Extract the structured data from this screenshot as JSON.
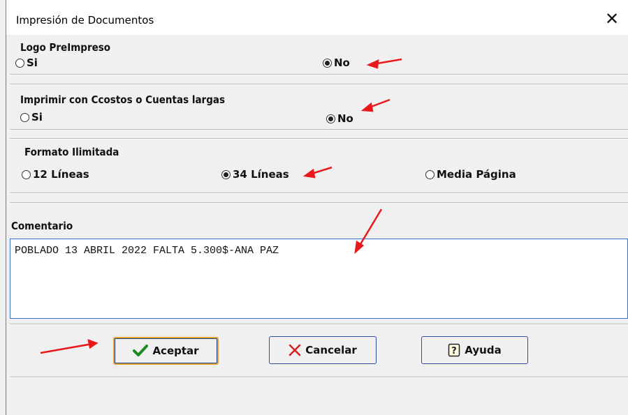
{
  "window": {
    "title": "Impresión de Documentos",
    "close_glyph": "✕"
  },
  "logo_group": {
    "label": "Logo PreImpreso",
    "options": [
      "Si",
      "No"
    ],
    "selected": "No"
  },
  "ccostos_group": {
    "label": "Imprimir con Ccostos o Cuentas largas",
    "options": [
      "Si",
      "No"
    ],
    "selected": "No"
  },
  "formato_group": {
    "label": "Formato Ilimitada",
    "options": [
      "12 Líneas",
      "34 Líneas",
      "Media Página"
    ],
    "selected": "34 Líneas"
  },
  "comentario": {
    "label": "Comentario",
    "value": "POBLADO 13 ABRIL 2022 FALTA 5.300$-ANA PAZ"
  },
  "buttons": {
    "accept": "Aceptar",
    "cancel": "Cancelar",
    "help": "Ayuda"
  },
  "icons": {
    "accept": "checkmark-icon",
    "cancel": "x-icon",
    "help": "question-icon"
  },
  "colors": {
    "annotation": "#e8191b",
    "accent_border": "#2a4f9a",
    "default_border": "#e3a534",
    "textarea_border": "#3c6fc8"
  }
}
